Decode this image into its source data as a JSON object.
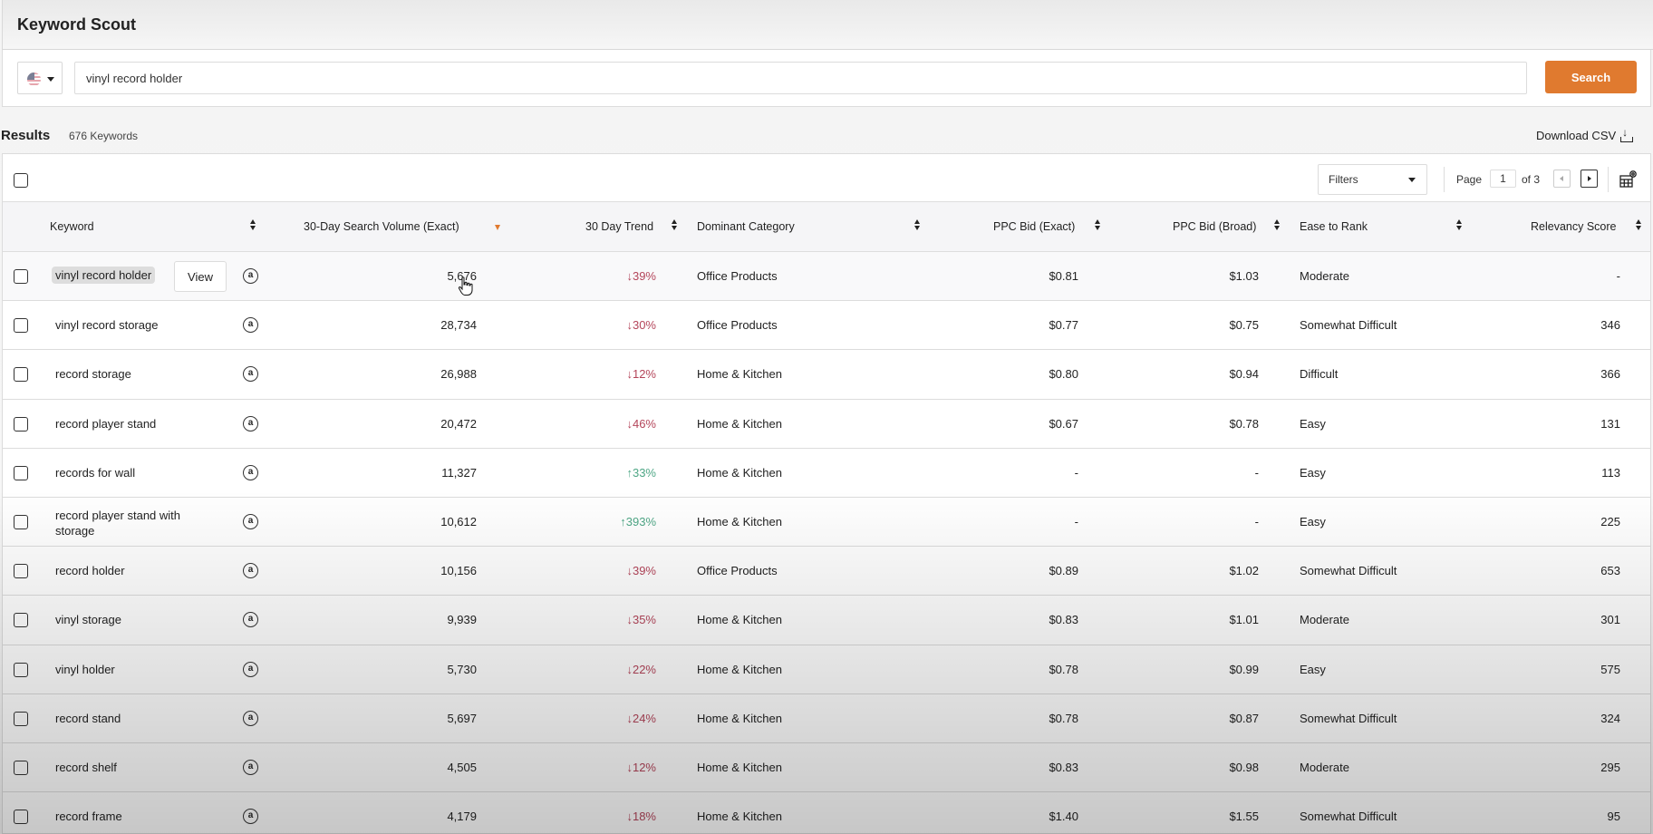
{
  "app": {
    "title": "Keyword Scout"
  },
  "search": {
    "country_icon": "us-flag-icon",
    "query": "vinyl record holder",
    "button_label": "Search"
  },
  "results": {
    "label": "Results",
    "count": "676 Keywords",
    "download_label": "Download CSV"
  },
  "toolbar": {
    "filters_label": "Filters",
    "page_label": "Page",
    "page_current": "1",
    "page_of": "of 3"
  },
  "columns": [
    {
      "label": "Keyword",
      "sort": "both"
    },
    {
      "label": "30-Day Search Volume (Exact)",
      "sort": "desc-active"
    },
    {
      "label": "30 Day Trend",
      "sort": "both"
    },
    {
      "label": "Dominant Category",
      "sort": "both"
    },
    {
      "label": "PPC Bid (Exact)",
      "sort": "both"
    },
    {
      "label": "PPC Bid (Broad)",
      "sort": "both"
    },
    {
      "label": "Ease to Rank",
      "sort": "both"
    },
    {
      "label": "Relevancy Score",
      "sort": "both"
    }
  ],
  "view_label": "View",
  "colors": {
    "accent": "#e07a2f",
    "trend_down": "#b4455a",
    "trend_up": "#4fa786"
  },
  "rows": [
    {
      "keyword": "vinyl record holder",
      "volume": "5,676",
      "trend_dir": "down",
      "trend": "39%",
      "category": "Office Products",
      "ppc_exact": "$0.81",
      "ppc_broad": "$1.03",
      "ease": "Moderate",
      "relevancy": "-",
      "hovered": true
    },
    {
      "keyword": "vinyl record storage",
      "volume": "28,734",
      "trend_dir": "down",
      "trend": "30%",
      "category": "Office Products",
      "ppc_exact": "$0.77",
      "ppc_broad": "$0.75",
      "ease": "Somewhat Difficult",
      "relevancy": "346"
    },
    {
      "keyword": "record storage",
      "volume": "26,988",
      "trend_dir": "down",
      "trend": "12%",
      "category": "Home & Kitchen",
      "ppc_exact": "$0.80",
      "ppc_broad": "$0.94",
      "ease": "Difficult",
      "relevancy": "366"
    },
    {
      "keyword": "record player stand",
      "volume": "20,472",
      "trend_dir": "down",
      "trend": "46%",
      "category": "Home & Kitchen",
      "ppc_exact": "$0.67",
      "ppc_broad": "$0.78",
      "ease": "Easy",
      "relevancy": "131"
    },
    {
      "keyword": "records for wall",
      "volume": "11,327",
      "trend_dir": "up",
      "trend": "33%",
      "category": "Home & Kitchen",
      "ppc_exact": "-",
      "ppc_broad": "-",
      "ease": "Easy",
      "relevancy": "113"
    },
    {
      "keyword": "record player stand with storage",
      "volume": "10,612",
      "trend_dir": "up",
      "trend": "393%",
      "category": "Home & Kitchen",
      "ppc_exact": "-",
      "ppc_broad": "-",
      "ease": "Easy",
      "relevancy": "225"
    },
    {
      "keyword": "record holder",
      "volume": "10,156",
      "trend_dir": "down",
      "trend": "39%",
      "category": "Office Products",
      "ppc_exact": "$0.89",
      "ppc_broad": "$1.02",
      "ease": "Somewhat Difficult",
      "relevancy": "653"
    },
    {
      "keyword": "vinyl storage",
      "volume": "9,939",
      "trend_dir": "down",
      "trend": "35%",
      "category": "Home & Kitchen",
      "ppc_exact": "$0.83",
      "ppc_broad": "$1.01",
      "ease": "Moderate",
      "relevancy": "301"
    },
    {
      "keyword": "vinyl holder",
      "volume": "5,730",
      "trend_dir": "down",
      "trend": "22%",
      "category": "Home & Kitchen",
      "ppc_exact": "$0.78",
      "ppc_broad": "$0.99",
      "ease": "Easy",
      "relevancy": "575"
    },
    {
      "keyword": "record stand",
      "volume": "5,697",
      "trend_dir": "down",
      "trend": "24%",
      "category": "Home & Kitchen",
      "ppc_exact": "$0.78",
      "ppc_broad": "$0.87",
      "ease": "Somewhat Difficult",
      "relevancy": "324"
    },
    {
      "keyword": "record shelf",
      "volume": "4,505",
      "trend_dir": "down",
      "trend": "12%",
      "category": "Home & Kitchen",
      "ppc_exact": "$0.83",
      "ppc_broad": "$0.98",
      "ease": "Moderate",
      "relevancy": "295"
    },
    {
      "keyword": "record frame",
      "volume": "4,179",
      "trend_dir": "down",
      "trend": "18%",
      "category": "Home & Kitchen",
      "ppc_exact": "$1.40",
      "ppc_broad": "$1.55",
      "ease": "Somewhat Difficult",
      "relevancy": "95"
    }
  ]
}
